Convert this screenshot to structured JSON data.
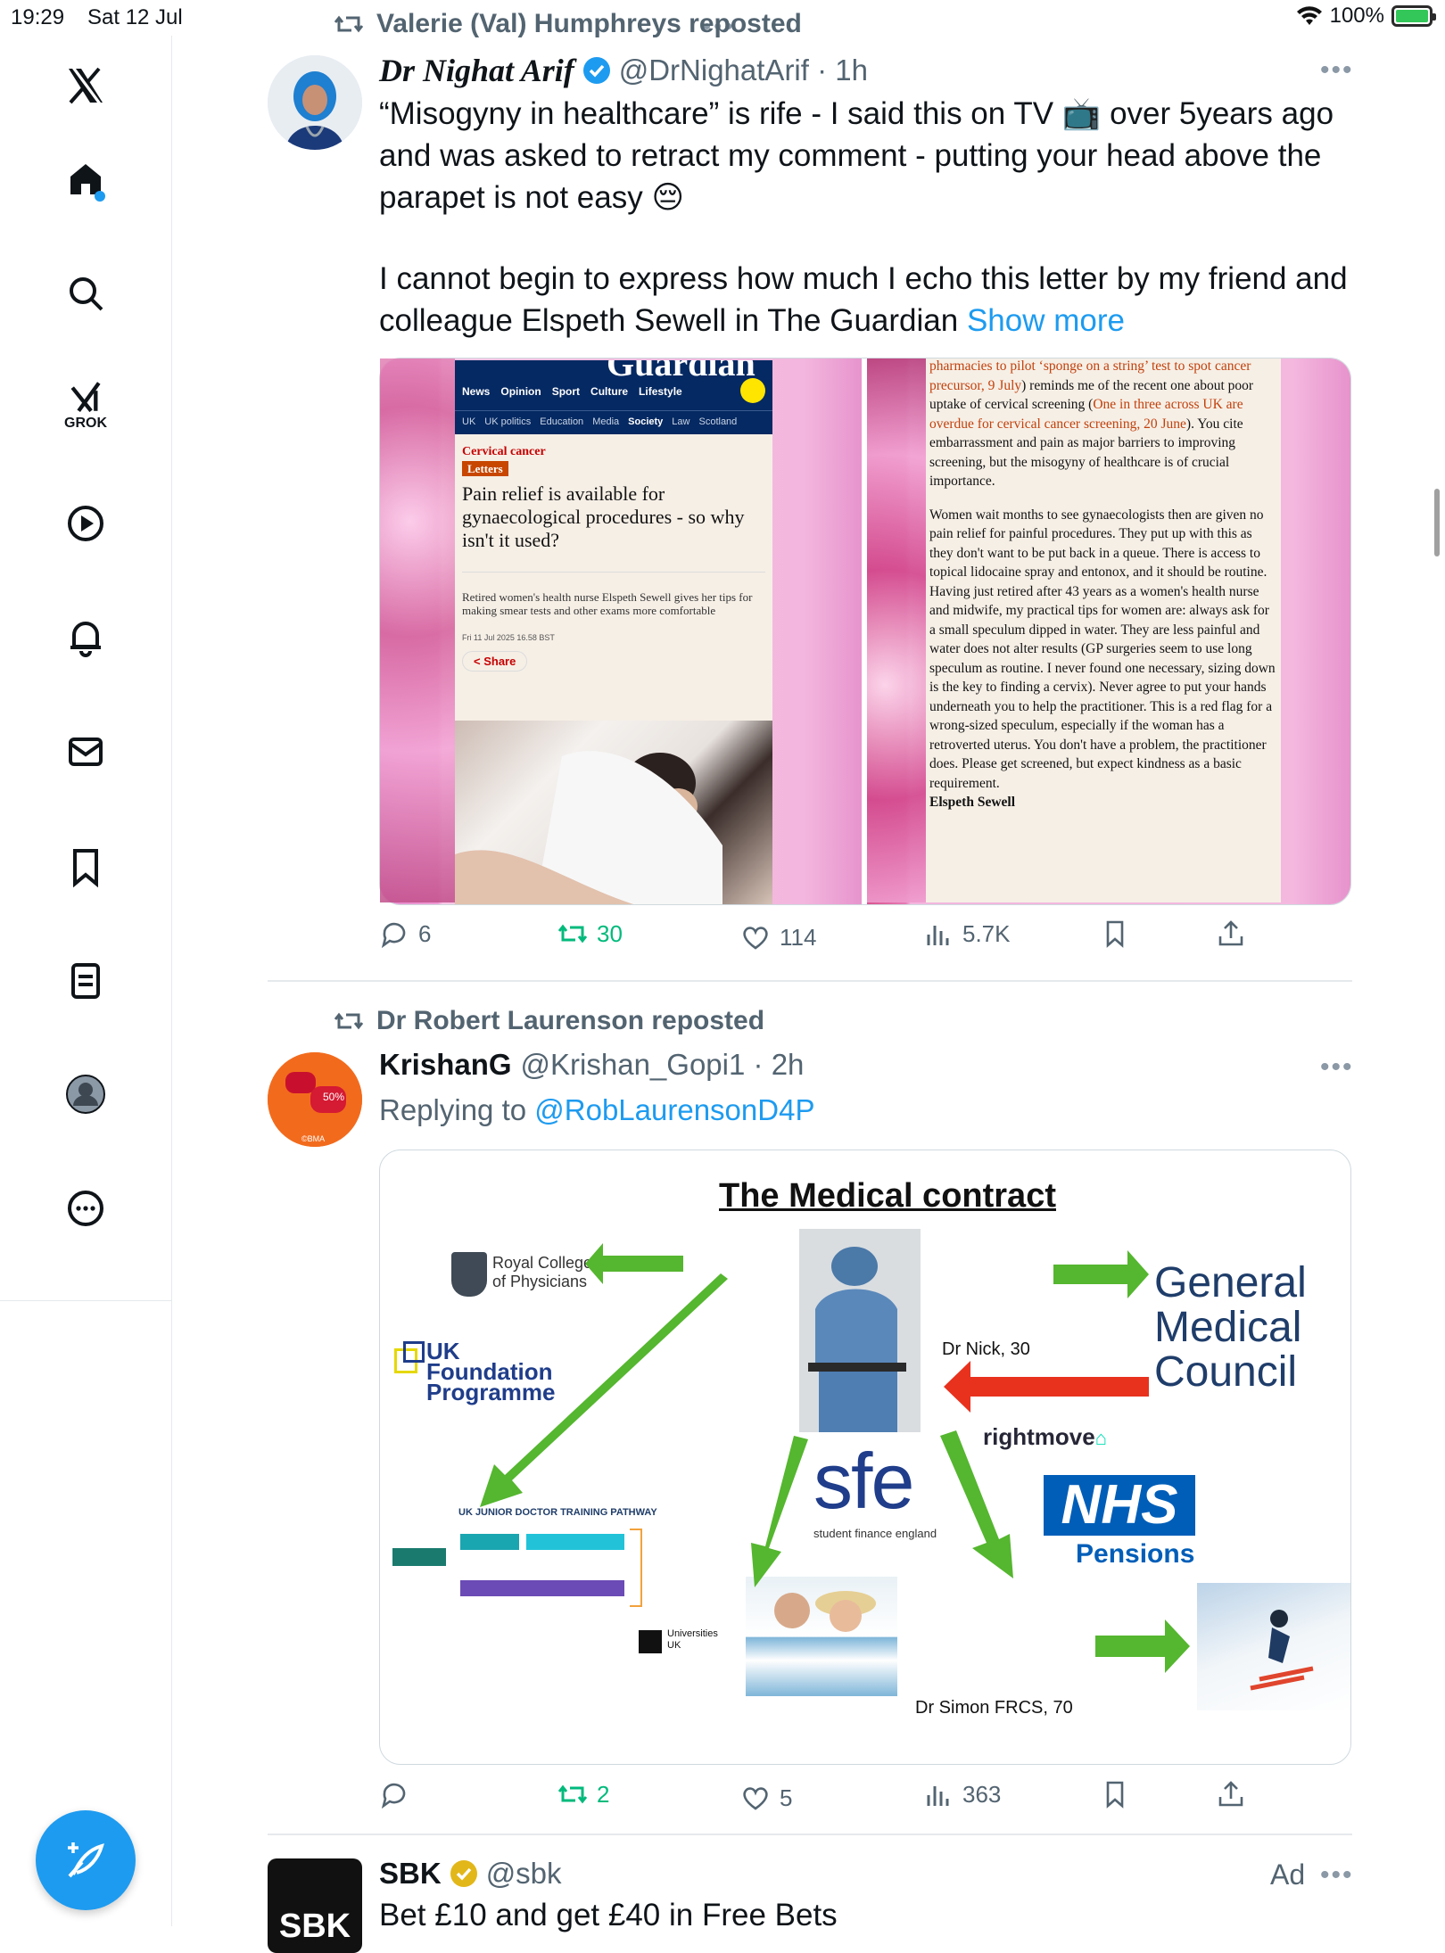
{
  "status_bar": {
    "time": "19:29",
    "date": "Sat 12 Jul",
    "battery": "100%"
  },
  "sidebar": {
    "items": [
      "x-logo",
      "home",
      "search",
      "grok",
      "video",
      "notifications",
      "messages",
      "bookmarks",
      "lists",
      "profile",
      "more"
    ],
    "grok_label": "GROK"
  },
  "tweets": [
    {
      "reposted_by": "Valerie (Val) Humphreys reposted",
      "display_name": "Dr Nighat Arif",
      "handle": "@DrNighatArif",
      "time": "1h",
      "verified": true,
      "text_p1": "“Misogyny in healthcare” is rife - I said this on TV 📺 over 5years ago and was asked to retract my comment - putting your head above the parapet is not easy 😔",
      "text_p2": " I cannot begin to express how much I echo this letter by my friend and colleague Elspeth Sewell in The Guardian ",
      "show_more": "Show more",
      "image1": {
        "masthead": "Guardian",
        "nav": [
          "News",
          "Opinion",
          "Sport",
          "Culture",
          "Lifestyle"
        ],
        "subnav": [
          "UK",
          "UK politics",
          "Education",
          "Media",
          "Society",
          "Law",
          "Scotland"
        ],
        "kicker": "Cervical cancer",
        "tag": "Letters",
        "headline": "Pain relief is available for gynaecological procedures - so why isn't it used?",
        "standfirst": "Retired women's health nurse Elspeth Sewell gives her tips for making smear tests and other exams more comfortable",
        "dateline": "Fri 11 Jul 2025 16.58 BST",
        "share": "Share"
      },
      "image2": {
        "link_text": "pharmacies to pilot ‘sponge on a string’ test to spot cancer precursor, 9 July",
        "text_a": ") reminds me of the recent one about poor uptake of cervical screening (",
        "link_text_2": "One in three across UK are overdue for cervical cancer screening, 20 June",
        "text_b": "). You cite embarrassment and pain as major barriers to improving screening, but the misogyny of healthcare is of crucial importance.",
        "para2": "Women wait months to see gynaecologists then are given no pain relief for painful procedures. They put up with this as they don't want to be put back in a queue. There is access to topical lidocaine spray and entonox, and it should be routine. Having just retired after 43 years as a women's health nurse and midwife, my practical tips for women are: always ask for a small speculum dipped in water. They are less painful and water does not alter results (GP surgeries seem to use long speculum as routine. I never found one necessary, sizing down is the key to finding a cervix). Never agree to put your hands underneath you to help the practitioner. This is a red flag for a wrong-sized speculum, especially if the woman has a retroverted uterus. You don't have a problem, the practitioner does. Please get screened, but expect kindness as a basic requirement.",
        "signature": "Elspeth Sewell"
      },
      "replies": "6",
      "reposts": "30",
      "likes": "114",
      "views": "5.7K"
    },
    {
      "reposted_by": "Dr Robert Laurenson reposted",
      "display_name": "KrishanG",
      "handle": "@Krishan_Gopi1",
      "time": "2h",
      "replying_prefix": "Replying to ",
      "replying_to": "@RobLaurensonD4P",
      "avatar_text": "50%",
      "avatar_sub": "©BMA",
      "diagram": {
        "title": "The Medical contract",
        "rcp": "Royal College of Physicians",
        "ukfp_1": "UK",
        "ukfp_2": "Foundation",
        "ukfp_3": "Programme",
        "gmc_1": "General",
        "gmc_2": "Medical",
        "gmc_3": "Council",
        "dr_nick": "Dr Nick, 30",
        "rightmove": "rightmove",
        "sfe": "sfe",
        "sfe_sub": "student finance england",
        "nhs": "NHS",
        "pensions": "Pensions",
        "pathway_title": "UK JUNIOR DOCTOR TRAINING PATHWAY",
        "universities": "Universities UK",
        "dr_simon": "Dr Simon FRCS, 70"
      },
      "replies": "",
      "reposts": "2",
      "likes": "5",
      "views": "363"
    },
    {
      "display_name": "SBK",
      "handle": "@sbk",
      "ad_label": "Ad",
      "avatar_text": "SBK",
      "text": "Bet £10 and get £40 in Free Bets"
    }
  ]
}
